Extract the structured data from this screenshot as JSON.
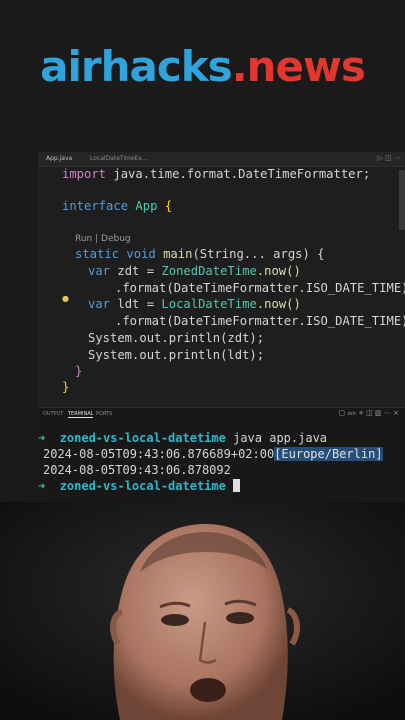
{
  "brand": {
    "part1": "airhacks",
    "dot": ".",
    "part2": "news"
  },
  "editor": {
    "tabs": [
      "App.java",
      "LocalDateTimeEx..."
    ],
    "lines": {
      "import_kw": "import",
      "import_rest": " java.time.format.DateTimeFormatter;",
      "interface_kw": "interface",
      "interface_name": "App",
      "codelens": "Run | Debug",
      "static_kw": "static",
      "void_kw": "void",
      "main_fn": "main",
      "main_params": "(String... args) {",
      "var_kw": "var",
      "zdt_decl": " zdt = ",
      "zdt_type": "ZonedDateTime",
      "now_call": ".now()",
      "fmt1": ".format(DateTimeFormatter.ISO_DATE_TIME);",
      "ldt_decl": " ldt = ",
      "ldt_type": "LocalDateTime",
      "fmt2": ".format(DateTimeFormatter.ISO_DATE_TIME);",
      "println1": "System.out.println(zdt);",
      "println2": "System.out.println(ldt);",
      "close_method": "}",
      "close_iface": "}"
    }
  },
  "panel": {
    "tabs": [
      "OUTPUT",
      "TERMINAL",
      "PORTS"
    ],
    "active_tab": "TERMINAL",
    "shell_label": "zsh"
  },
  "terminal": {
    "prompt_arrow": "➜",
    "cwd": "zoned-vs-local-datetime",
    "command": "java app.java",
    "out1_main": "2024-08-05T09:43:06.876689+02:00",
    "out1_zone": "[Europe/Berlin]",
    "out2": "2024-08-05T09:43:06.878092"
  }
}
